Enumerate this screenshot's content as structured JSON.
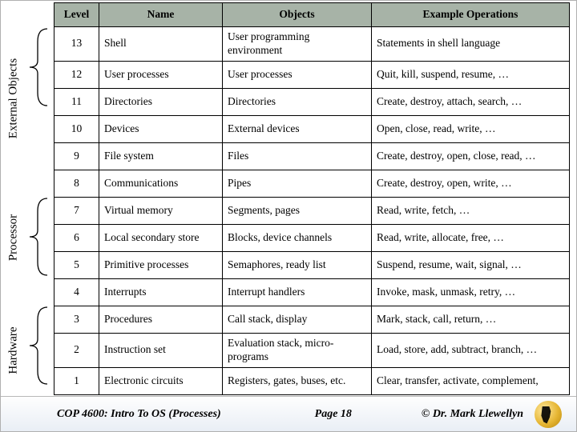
{
  "table": {
    "headers": {
      "level": "Level",
      "name": "Name",
      "objects": "Objects",
      "ops": "Example Operations"
    },
    "rows": [
      {
        "level": "13",
        "name": "Shell",
        "objects": "User programming environment",
        "ops": "Statements in shell language"
      },
      {
        "level": "12",
        "name": "User processes",
        "objects": "User processes",
        "ops": "Quit, kill, suspend, resume, …"
      },
      {
        "level": "11",
        "name": "Directories",
        "objects": "Directories",
        "ops": "Create, destroy, attach, search, …"
      },
      {
        "level": "10",
        "name": "Devices",
        "objects": "External devices",
        "ops": "Open, close, read, write, …"
      },
      {
        "level": "9",
        "name": "File system",
        "objects": "Files",
        "ops": "Create, destroy, open, close, read, …"
      },
      {
        "level": "8",
        "name": "Communications",
        "objects": "Pipes",
        "ops": "Create, destroy, open, write, …"
      },
      {
        "level": "7",
        "name": "Virtual memory",
        "objects": "Segments, pages",
        "ops": "Read, write, fetch, …"
      },
      {
        "level": "6",
        "name": "Local secondary store",
        "objects": "Blocks, device channels",
        "ops": "Read, write, allocate, free, …"
      },
      {
        "level": "5",
        "name": "Primitive processes",
        "objects": "Semaphores, ready list",
        "ops": "Suspend, resume, wait, signal, …"
      },
      {
        "level": "4",
        "name": "Interrupts",
        "objects": "Interrupt handlers",
        "ops": "Invoke, mask, unmask, retry, …"
      },
      {
        "level": "3",
        "name": "Procedures",
        "objects": "Call stack, display",
        "ops": "Mark, stack, call, return, …"
      },
      {
        "level": "2",
        "name": "Instruction set",
        "objects": "Evaluation stack, micro-programs",
        "ops": "Load, store, add, subtract, branch, …"
      },
      {
        "level": "1",
        "name": "Electronic circuits",
        "objects": "Registers, gates, buses, etc.",
        "ops": "Clear, transfer, activate, complement,"
      }
    ]
  },
  "brackets": {
    "external": "External Objects",
    "processor": "Processor",
    "hardware": "Hardware"
  },
  "footer": {
    "left": "COP 4600: Intro To OS  (Processes)",
    "page": "Page 18",
    "right": "© Dr. Mark Llewellyn"
  },
  "chart_data": {
    "type": "table",
    "title": "OS design hierarchy levels",
    "columns": [
      "Level",
      "Name",
      "Objects",
      "Example Operations"
    ],
    "groups": [
      {
        "label": "External Objects",
        "levels": [
          13,
          12,
          11,
          10,
          9
        ]
      },
      {
        "label": "Processor",
        "levels": [
          7,
          6,
          5
        ]
      },
      {
        "label": "Hardware",
        "levels": [
          3,
          2,
          1
        ]
      }
    ],
    "rows": [
      [
        13,
        "Shell",
        "User programming environment",
        "Statements in shell language"
      ],
      [
        12,
        "User processes",
        "User processes",
        "Quit, kill, suspend, resume, …"
      ],
      [
        11,
        "Directories",
        "Directories",
        "Create, destroy, attach, search, …"
      ],
      [
        10,
        "Devices",
        "External devices",
        "Open, close, read, write, …"
      ],
      [
        9,
        "File system",
        "Files",
        "Create, destroy, open, close, read, …"
      ],
      [
        8,
        "Communications",
        "Pipes",
        "Create, destroy, open, write, …"
      ],
      [
        7,
        "Virtual memory",
        "Segments, pages",
        "Read, write, fetch, …"
      ],
      [
        6,
        "Local secondary store",
        "Blocks, device channels",
        "Read, write, allocate, free, …"
      ],
      [
        5,
        "Primitive processes",
        "Semaphores, ready list",
        "Suspend, resume, wait, signal, …"
      ],
      [
        4,
        "Interrupts",
        "Interrupt handlers",
        "Invoke, mask, unmask, retry, …"
      ],
      [
        3,
        "Procedures",
        "Call stack, display",
        "Mark, stack, call, return, …"
      ],
      [
        2,
        "Instruction set",
        "Evaluation stack, micro-programs",
        "Load, store, add, subtract, branch, …"
      ],
      [
        1,
        "Electronic circuits",
        "Registers, gates, buses, etc.",
        "Clear, transfer, activate, complement,"
      ]
    ]
  }
}
